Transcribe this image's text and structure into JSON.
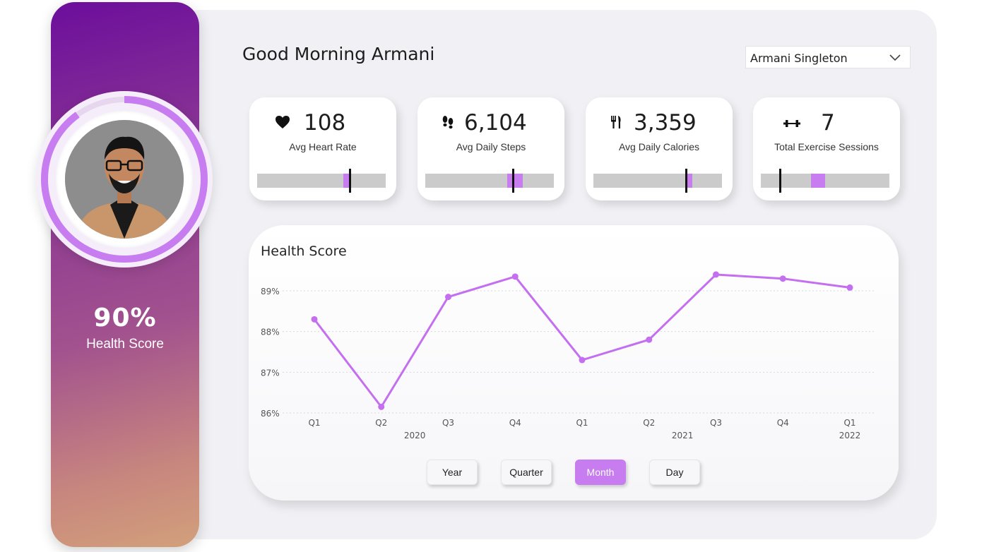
{
  "header": {
    "greeting": "Good Morning Armani",
    "user_select": {
      "value": "Armani Singleton"
    }
  },
  "profile": {
    "score_value": "90%",
    "score_label": "Health Score",
    "score_fraction": 0.9
  },
  "kpis": [
    {
      "icon": "heart-icon",
      "value": "108",
      "label": "Avg Heart Rate",
      "fill_start": 0.67,
      "fill_end": 0.72,
      "marker": 0.72
    },
    {
      "icon": "footprints-icon",
      "value": "6,104",
      "label": "Avg Daily Steps",
      "fill_start": 0.64,
      "fill_end": 0.76,
      "marker": 0.685
    },
    {
      "icon": "fork-knife-icon",
      "value": "3,359",
      "label": "Avg Daily Calories",
      "fill_start": 0.72,
      "fill_end": 0.77,
      "marker": 0.72
    },
    {
      "icon": "dumbbell-icon",
      "value": "7",
      "label": "Total Exercise Sessions",
      "fill_start": 0.39,
      "fill_end": 0.5,
      "marker": 0.15
    }
  ],
  "chart_data": {
    "type": "line",
    "title": "Health Score",
    "x": [
      "Q1",
      "Q2",
      "Q3",
      "Q4",
      "Q1",
      "Q2",
      "Q3",
      "Q4",
      "Q1"
    ],
    "year_groups": [
      {
        "label": "2020",
        "start": 0,
        "end": 3
      },
      {
        "label": "2021",
        "start": 4,
        "end": 7
      },
      {
        "label": "2022",
        "start": 8,
        "end": 8
      }
    ],
    "series": [
      {
        "values": [
          88.3,
          86.15,
          88.85,
          89.35,
          87.3,
          87.8,
          89.4,
          89.3,
          89.08
        ]
      }
    ],
    "y_ticks": [
      "86%",
      "87%",
      "88%",
      "89%"
    ],
    "y_tick_values": [
      86,
      87,
      88,
      89
    ],
    "ylim": [
      86,
      89
    ],
    "grid": true,
    "line_color": "#c46ef0"
  },
  "granularity": {
    "options": [
      "Year",
      "Quarter",
      "Month",
      "Day"
    ],
    "selected": "Month"
  }
}
